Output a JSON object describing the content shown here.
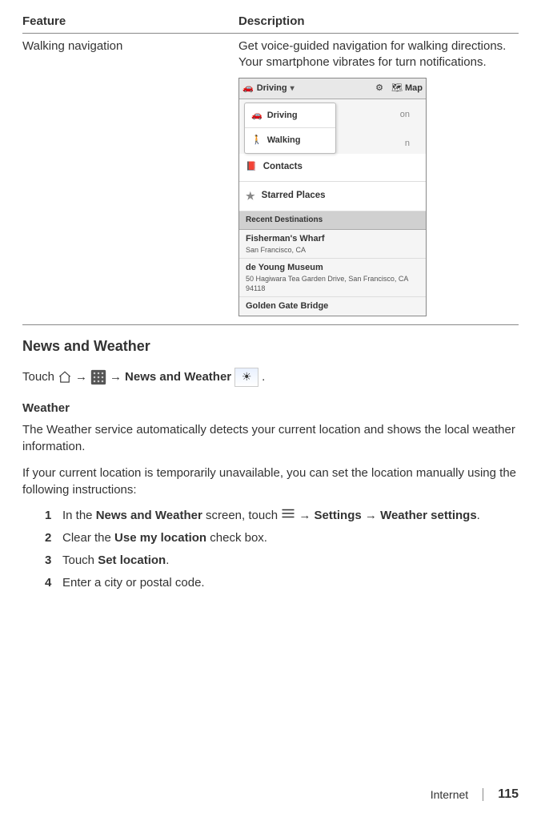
{
  "table": {
    "header_feature": "Feature",
    "header_description": "Description",
    "row_feature": "Walking navigation",
    "row_desc": "Get voice-guided navigation for walking directions. Your smartphone vibrates for turn notifications."
  },
  "screenshot": {
    "topbar_driving": "Driving",
    "topbar_map": "Map",
    "dropdown_driving": "Driving",
    "dropdown_walking": "Walking",
    "behind_on": "on",
    "behind_n": "n",
    "list_contacts": "Contacts",
    "list_starred": "Starred Places",
    "recent_header": "Recent Destinations",
    "dest1_name": "Fisherman's Wharf",
    "dest1_addr": "San Francisco, CA",
    "dest2_name": "de Young Museum",
    "dest2_addr": "50 Hagiwara Tea Garden Drive, San Francisco, CA 94118",
    "dest3_name": "Golden Gate Bridge"
  },
  "section_heading": "News and Weather",
  "touch_line": {
    "touch": "Touch",
    "news_weather_bold": "News and Weather",
    "period": "."
  },
  "arrow": "→",
  "weather": {
    "heading": "Weather",
    "p1": "The Weather service automatically detects your current location and shows the local weather information.",
    "p2": "If your current location is temporarily unavailable, you can set the location manually using the following instructions:"
  },
  "steps": {
    "s1_a": "In the ",
    "s1_b": "News and Weather",
    "s1_c": " screen, touch ",
    "s1_d": "Settings",
    "s1_e": "Weather settings",
    "s1_f": ".",
    "s2_a": "Clear the ",
    "s2_b": "Use my location",
    "s2_c": " check box.",
    "s3_a": "Touch ",
    "s3_b": "Set location",
    "s3_c": ".",
    "s4": "Enter a city or postal code."
  },
  "footer": {
    "section": "Internet",
    "page": "115"
  }
}
